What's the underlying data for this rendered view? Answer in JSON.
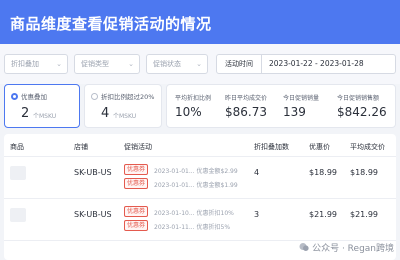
{
  "header": {
    "title": "商品维度查看促销活动的情况"
  },
  "filters": {
    "select1": {
      "placeholder": "折扣叠加"
    },
    "select2": {
      "placeholder": "促销类型"
    },
    "select3": {
      "placeholder": "促销状态"
    },
    "select4": {
      "placeholder": "国家"
    },
    "time_label": "活动时间",
    "time_range": "2023-01-22  -  2023-01-28"
  },
  "summary": {
    "card1": {
      "label": "优惠叠加",
      "value": "2",
      "unit": "个MSKU",
      "selected": true
    },
    "card2": {
      "label": "折扣比例超过20%",
      "value": "4",
      "unit": "个MSKU",
      "selected": false
    },
    "metrics": [
      {
        "label": "平均折扣比例",
        "value": "10%"
      },
      {
        "label": "昨日平均成交价",
        "value": "$86.73"
      },
      {
        "label": "今日促销销量",
        "value": "139"
      },
      {
        "label": "今日促销销售额",
        "value": "$842.26"
      }
    ]
  },
  "table": {
    "columns": [
      "商品",
      "店铺",
      "促销活动",
      "折扣叠加数",
      "优惠价",
      "平均成交价"
    ],
    "rows": [
      {
        "store": "SK-UB-US",
        "promos": [
          {
            "tag": "优惠券",
            "text": "2023-01-01... 优惠金额$2.99"
          },
          {
            "tag": "优惠券",
            "text": "2023-01-01... 优惠金额$1.99"
          }
        ],
        "stack_count": "4",
        "promo_price": "$18.99",
        "avg_price": "$18.99"
      },
      {
        "store": "SK-UB-US",
        "promos": [
          {
            "tag": "优惠券",
            "text": "2023-01-10... 优惠折扣10%"
          },
          {
            "tag": "优惠券",
            "text": "2023-01-11... 优惠折扣5%"
          }
        ],
        "stack_count": "3",
        "promo_price": "$21.99",
        "avg_price": "$21.99"
      }
    ]
  },
  "watermark": {
    "text": "公众号 · Regan跨境"
  },
  "colors": {
    "brand": "#4d78f0",
    "promo_tag": "#e45a4e"
  }
}
